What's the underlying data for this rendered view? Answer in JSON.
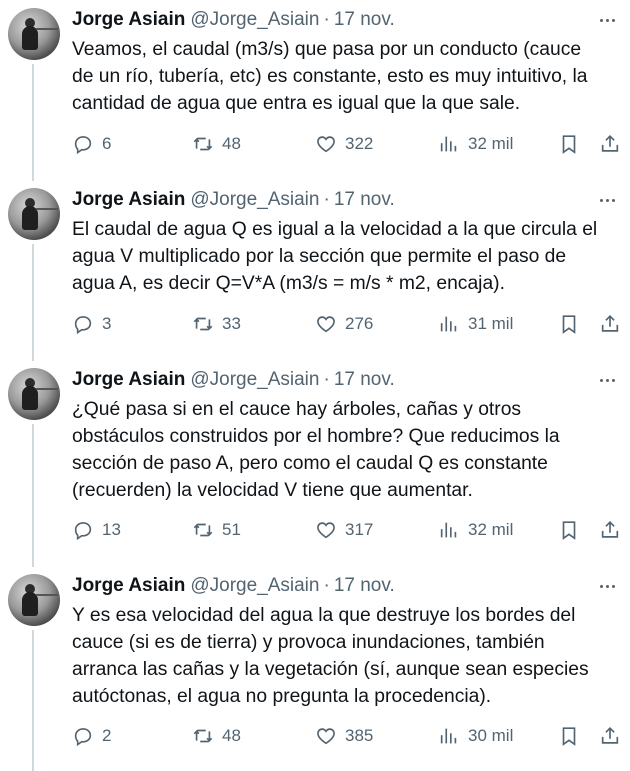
{
  "tweets": [
    {
      "author_name": "Jorge Asiain",
      "handle": "@Jorge_Asiain",
      "separator": "·",
      "date": "17 nov.",
      "lines": [
        "Veamos, el caudal (m3/s) que pasa por un conducto (cauce",
        "de un río, tubería, etc) es constante, esto es muy intuitivo, la",
        "cantidad de agua que entra es igual que la que sale."
      ],
      "replies": "6",
      "retweets": "48",
      "likes": "322",
      "views": "32 mil"
    },
    {
      "author_name": "Jorge Asiain",
      "handle": "@Jorge_Asiain",
      "separator": "·",
      "date": "17 nov.",
      "lines": [
        "El caudal de agua Q es igual a la velocidad a la que circula el",
        "agua V multiplicado por la sección que permite el paso de",
        "agua A, es decir Q=V*A (m3/s = m/s * m2, encaja)."
      ],
      "replies": "3",
      "retweets": "33",
      "likes": "276",
      "views": "31 mil"
    },
    {
      "author_name": "Jorge Asiain",
      "handle": "@Jorge_Asiain",
      "separator": "·",
      "date": "17 nov.",
      "lines": [
        "¿Qué pasa si en el cauce hay árboles, cañas y otros",
        "obstáculos construidos por el hombre? Que reducimos la",
        "sección de paso A, pero como el caudal Q es constante",
        "(recuerden) la velocidad V tiene que aumentar."
      ],
      "replies": "13",
      "retweets": "51",
      "likes": "317",
      "views": "32 mil"
    },
    {
      "author_name": "Jorge Asiain",
      "handle": "@Jorge_Asiain",
      "separator": "·",
      "date": "17 nov.",
      "lines": [
        "Y es esa velocidad del agua la que destruye los bordes del",
        "cauce (si es de tierra) y provoca inundaciones, también",
        "arranca las cañas y la vegetación (sí, aunque sean especies",
        "autóctonas, el agua no pregunta la procedencia)."
      ],
      "replies": "2",
      "retweets": "48",
      "likes": "385",
      "views": "30 mil"
    }
  ],
  "icons": {
    "reply": "reply-icon",
    "retweet": "retweet-icon",
    "like": "heart-icon",
    "views": "views-icon",
    "bookmark": "bookmark-icon",
    "share": "share-icon",
    "more": "more-icon"
  },
  "colors": {
    "text": "#0f1419",
    "secondary": "#536471",
    "thread_line": "#cfd9de",
    "background": "#ffffff"
  }
}
